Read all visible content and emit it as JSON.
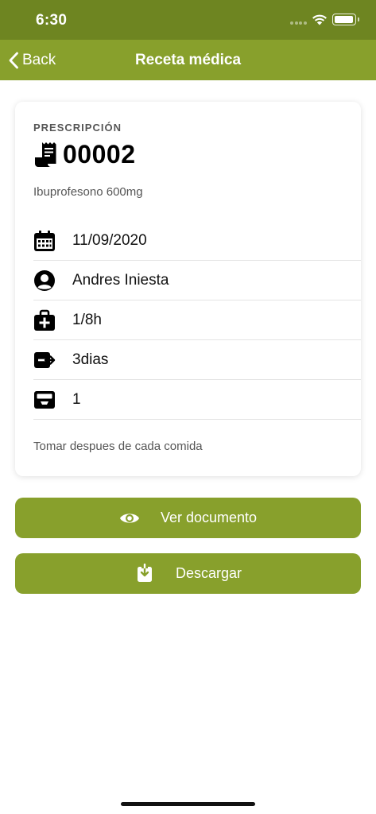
{
  "status_bar": {
    "time": "6:30"
  },
  "nav": {
    "back_label": "Back",
    "title": "Receta médica"
  },
  "prescription": {
    "section_label": "PRESCRIPCIÓN",
    "number": "00002",
    "drug": "Ibuprofesono 600mg",
    "rows": [
      {
        "icon": "calendar-icon",
        "value": "11/09/2020"
      },
      {
        "icon": "user-circle-icon",
        "value": "Andres Iniesta"
      },
      {
        "icon": "medkit-icon",
        "value": "1/8h"
      },
      {
        "icon": "sign-out-icon",
        "value": "3dias"
      },
      {
        "icon": "inbox-icon",
        "value": "1"
      }
    ],
    "note": "Tomar despues de cada comida"
  },
  "actions": {
    "view_label": "Ver documento",
    "download_label": "Descargar"
  },
  "colors": {
    "status_bar": "#6e8521",
    "accent": "#88a02c"
  }
}
